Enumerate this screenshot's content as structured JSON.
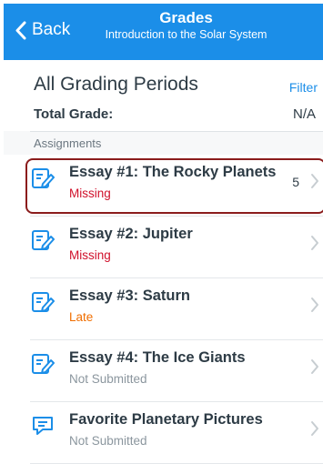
{
  "header": {
    "back_label": "Back",
    "title": "Grades",
    "subtitle": "Introduction to the Solar System",
    "bg_color": "#1b8ee8"
  },
  "period": {
    "title": "All Grading Periods",
    "filter_label": "Filter",
    "total_label": "Total Grade:",
    "total_value": "N/A"
  },
  "section_label": "Assignments",
  "colors": {
    "missing": "#d0112b",
    "late": "#f06e00",
    "not_submitted": "#8b969e",
    "accent": "#1b8ee8",
    "highlight": "#8b1c1c"
  },
  "assignments": [
    {
      "name": "Essay #1: The Rocky Planets",
      "status": "Missing",
      "score": "5",
      "icon": "assignment-icon"
    },
    {
      "name": "Essay #2: Jupiter",
      "status": "Missing",
      "score": "",
      "icon": "assignment-icon"
    },
    {
      "name": "Essay #3: Saturn",
      "status": "Late",
      "score": "",
      "icon": "assignment-icon"
    },
    {
      "name": "Essay #4: The Ice Giants",
      "status": "Not Submitted",
      "score": "",
      "icon": "assignment-icon"
    },
    {
      "name": "Favorite Planetary Pictures",
      "status": "Not Submitted",
      "score": "",
      "icon": "discussion-icon"
    }
  ]
}
